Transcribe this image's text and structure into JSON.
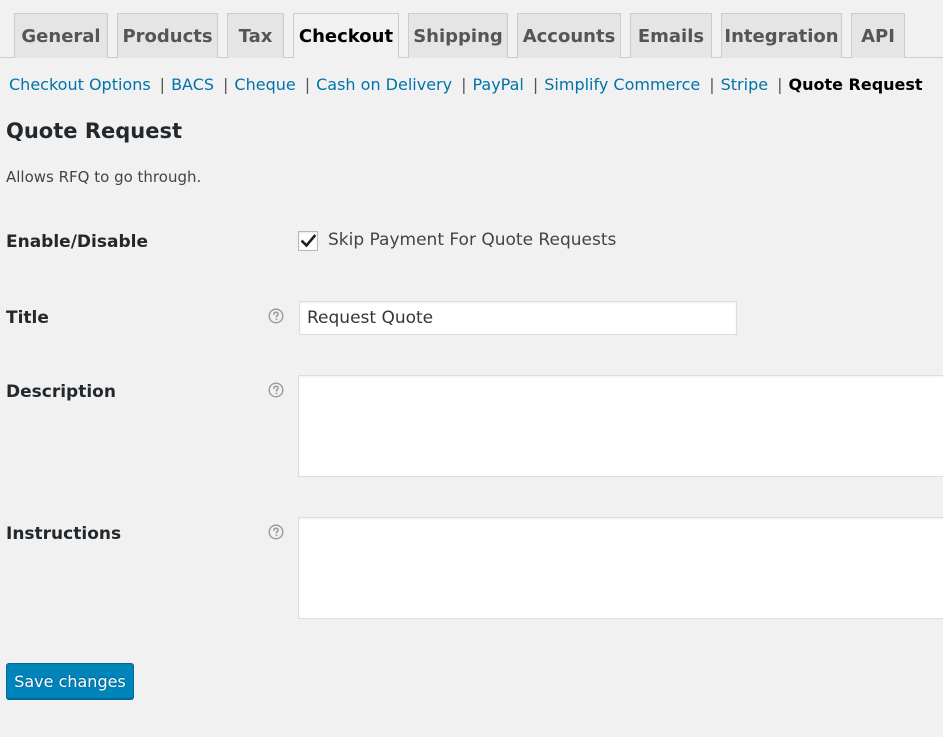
{
  "tabs": [
    {
      "label": "General",
      "active": false
    },
    {
      "label": "Products",
      "active": false
    },
    {
      "label": "Tax",
      "active": false
    },
    {
      "label": "Checkout",
      "active": true
    },
    {
      "label": "Shipping",
      "active": false
    },
    {
      "label": "Accounts",
      "active": false
    },
    {
      "label": "Emails",
      "active": false
    },
    {
      "label": "Integration",
      "active": false
    },
    {
      "label": "API",
      "active": false
    }
  ],
  "subnav": {
    "items": [
      "Checkout Options",
      "BACS",
      "Cheque",
      "Cash on Delivery",
      "PayPal",
      "Simplify Commerce",
      "Stripe"
    ],
    "current": "Quote Request",
    "separator": "|"
  },
  "page": {
    "title": "Quote Request",
    "description": "Allows RFQ to go through."
  },
  "fields": {
    "enable": {
      "label": "Enable/Disable",
      "checkbox_label": "Skip Payment For Quote Requests",
      "checked": true
    },
    "title": {
      "label": "Title",
      "value": "Request Quote"
    },
    "description": {
      "label": "Description",
      "value": ""
    },
    "instructions": {
      "label": "Instructions",
      "value": ""
    }
  },
  "actions": {
    "save_label": "Save changes"
  },
  "colors": {
    "link": "#0073aa",
    "primary_button": "#0085ba",
    "background": "#f1f1f1"
  },
  "icons": {
    "help": "help-tip-icon",
    "check": "checkmark-icon"
  }
}
